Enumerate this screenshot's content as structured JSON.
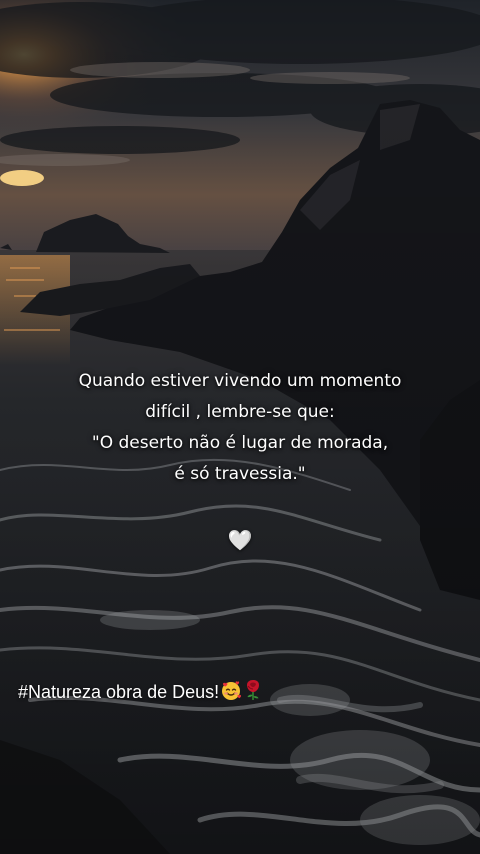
{
  "colors": {
    "sky_dark": "#2b2f36",
    "sunset": "#e08a3c",
    "sea": "#22262b",
    "foam": "#c9ccd0",
    "text": "#ffffff",
    "rose": "#c4142a"
  },
  "quote": {
    "line1": "Quando estiver vivendo um momento",
    "line2": "difícil , lembre-se que:",
    "line3": "\"O deserto não é lugar de morada,",
    "line4": "é só travessia.\""
  },
  "heart": "🤍",
  "caption": {
    "text": "#Natureza obra de Deus!",
    "emoji_face": "smiling-face-with-hearts-icon",
    "emoji_rose": "rose-icon"
  }
}
